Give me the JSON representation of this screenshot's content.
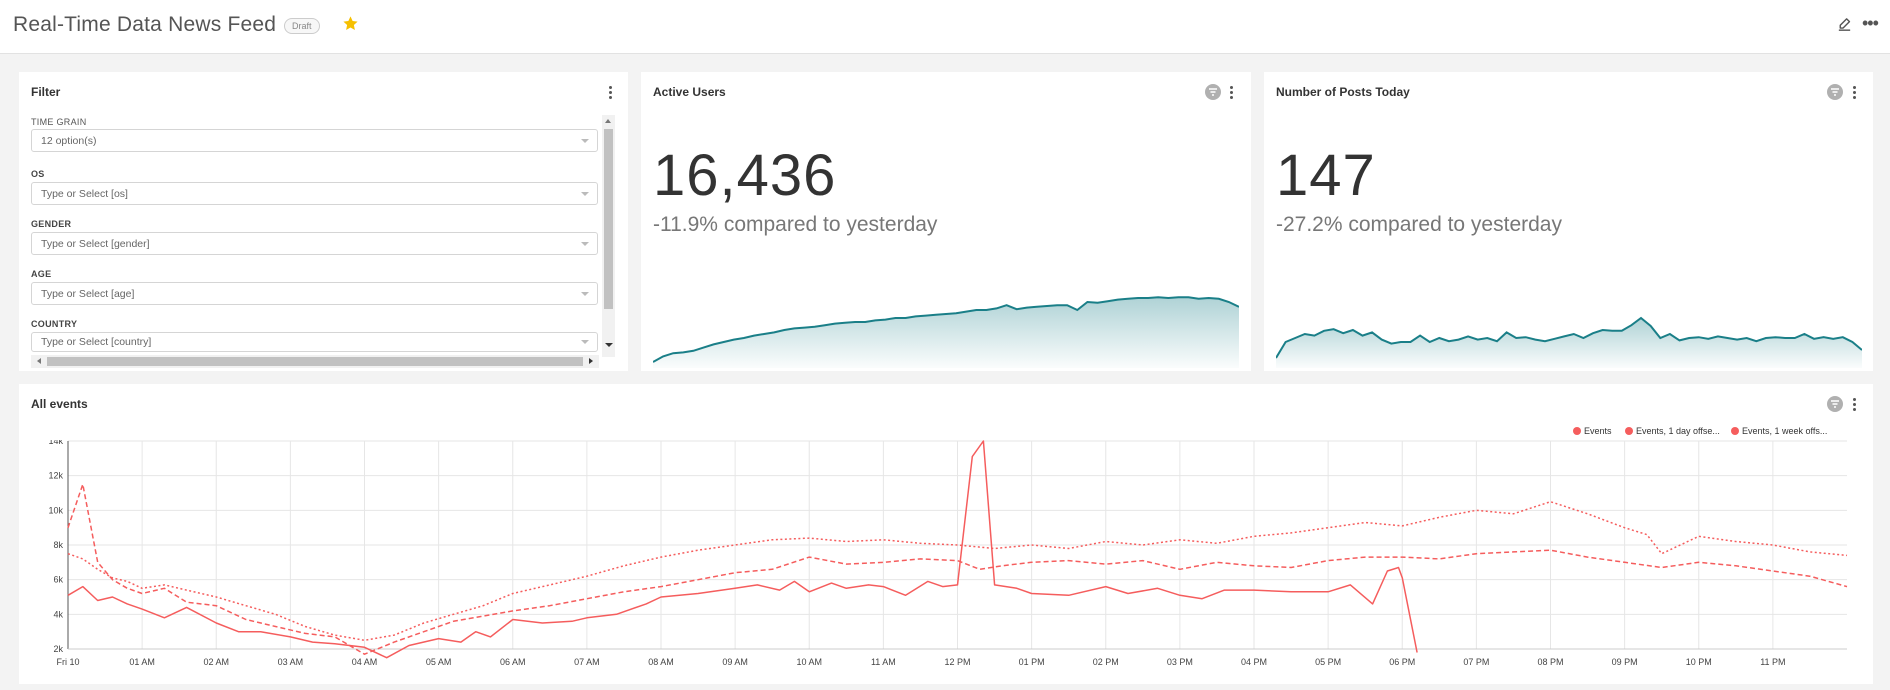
{
  "header": {
    "title": "Real-Time Data News Feed",
    "badge": "Draft",
    "icons": [
      "star-icon",
      "edit-icon",
      "more-icon"
    ],
    "star_color": "#f6c000"
  },
  "filter": {
    "title": "Filter",
    "fields": [
      {
        "label": "TIME GRAIN",
        "value": "12 option(s)"
      },
      {
        "label": "OS",
        "value": "Type or Select [os]"
      },
      {
        "label": "GENDER",
        "value": "Type or Select [gender]"
      },
      {
        "label": "AGE",
        "value": "Type or Select [age]"
      },
      {
        "label": "COUNTRY",
        "value": "Type or Select [country]"
      }
    ]
  },
  "active_users": {
    "title": "Active Users",
    "value": "16,436",
    "comparison": "-11.9% compared to yesterday"
  },
  "posts": {
    "title": "Number of Posts Today",
    "value": "147",
    "comparison": "-27.2% compared to yesterday"
  },
  "events": {
    "title": "All events",
    "legend": [
      "Events",
      "Events, 1 day offse...",
      "Events, 1 week offs..."
    ]
  },
  "colors": {
    "accent_teal": "#1a7f88",
    "events_red": "#f55d5d"
  },
  "chart_data": [
    {
      "type": "area",
      "name": "Active Users sparkline",
      "values": [
        5,
        12,
        16,
        17,
        19,
        23,
        27,
        30,
        33,
        35,
        38,
        40,
        42,
        45,
        47,
        48,
        49,
        51,
        53,
        54,
        55,
        55,
        57,
        58,
        60,
        60,
        62,
        63,
        64,
        65,
        66,
        68,
        70,
        70,
        72,
        76,
        71,
        73,
        74,
        75,
        76,
        76,
        70,
        80,
        79,
        81,
        83,
        84,
        85,
        85,
        86,
        85,
        86,
        86,
        84,
        85,
        84,
        80,
        74
      ],
      "ylim": [
        0,
        100
      ]
    },
    {
      "type": "area",
      "name": "Number of Posts Today sparkline",
      "values": [
        10,
        30,
        35,
        40,
        38,
        44,
        46,
        41,
        45,
        38,
        42,
        33,
        28,
        30,
        30,
        38,
        30,
        35,
        31,
        33,
        37,
        33,
        35,
        31,
        42,
        35,
        36,
        33,
        31,
        34,
        37,
        40,
        35,
        41,
        45,
        44,
        44,
        51,
        60,
        50,
        35,
        40,
        32,
        35,
        36,
        34,
        37,
        35,
        33,
        35,
        31,
        35,
        36,
        35,
        35,
        40,
        34,
        36,
        34,
        36,
        30,
        20
      ],
      "ylim": [
        0,
        100
      ]
    },
    {
      "type": "line",
      "title": "All events",
      "x_ticks": [
        "Fri 10",
        "01 AM",
        "02 AM",
        "03 AM",
        "04 AM",
        "05 AM",
        "06 AM",
        "07 AM",
        "08 AM",
        "09 AM",
        "10 AM",
        "11 AM",
        "12 PM",
        "01 PM",
        "02 PM",
        "03 PM",
        "04 PM",
        "05 PM",
        "06 PM",
        "07 PM",
        "08 PM",
        "09 PM",
        "10 PM",
        "11 PM"
      ],
      "y_ticks": [
        "2k",
        "4k",
        "6k",
        "8k",
        "10k",
        "12k",
        "14k"
      ],
      "ylim": [
        2000,
        14000
      ],
      "xlim": [
        0,
        24
      ],
      "grid": true,
      "legend_position": "top-right",
      "series": [
        {
          "name": "Events",
          "style": "solid",
          "x": [
            0,
            0.2,
            0.4,
            0.6,
            0.8,
            1.0,
            1.3,
            1.6,
            2.0,
            2.3,
            2.6,
            3.0,
            3.3,
            3.6,
            4.0,
            4.3,
            4.6,
            5.0,
            5.3,
            5.5,
            5.7,
            6.0,
            6.4,
            6.8,
            7.0,
            7.4,
            7.8,
            8.0,
            8.5,
            9.0,
            9.3,
            9.6,
            9.8,
            10.0,
            10.3,
            10.5,
            10.8,
            11.0,
            11.3,
            11.6,
            11.8,
            12.0,
            12.2,
            12.35,
            12.5,
            12.8,
            13.0,
            13.5,
            14.0,
            14.3,
            14.7,
            15.0,
            15.3,
            15.6,
            16.0,
            16.5,
            17.0,
            17.3,
            17.6,
            17.8,
            17.95,
            18.0,
            18.2
          ],
          "y": [
            5100,
            5600,
            4800,
            5000,
            4600,
            4300,
            3800,
            4400,
            3500,
            3000,
            3000,
            2700,
            2400,
            2300,
            2100,
            1500,
            2200,
            2600,
            2400,
            3000,
            2700,
            3700,
            3500,
            3600,
            3800,
            4000,
            4600,
            5000,
            5200,
            5500,
            5700,
            5400,
            5900,
            5300,
            5800,
            5500,
            5700,
            5600,
            5100,
            5900,
            5600,
            5700,
            13100,
            14000,
            5700,
            5500,
            5200,
            5100,
            5600,
            5200,
            5500,
            5100,
            4900,
            5400,
            5400,
            5300,
            5300,
            5700,
            4600,
            6500,
            6700,
            6100,
            1800
          ]
        },
        {
          "name": "Events, 1 day offse...",
          "style": "dashed",
          "x": [
            0,
            0.2,
            0.4,
            0.6,
            0.8,
            1.0,
            1.3,
            1.6,
            2.0,
            2.4,
            2.8,
            3.2,
            3.6,
            4.0,
            4.4,
            4.8,
            5.2,
            5.6,
            6.0,
            6.5,
            7.0,
            7.5,
            8.0,
            8.5,
            9.0,
            9.5,
            10.0,
            10.5,
            11.0,
            11.5,
            12.0,
            12.3,
            12.6,
            13.0,
            13.5,
            14.0,
            14.5,
            15.0,
            15.5,
            16.0,
            16.5,
            17.0,
            17.5,
            18.0,
            18.5,
            19.0,
            19.5,
            20.0,
            20.5,
            21.0,
            21.5,
            22.0,
            22.5,
            23.0,
            23.5,
            24.0
          ],
          "y": [
            9000,
            11500,
            7000,
            6000,
            5500,
            5200,
            5500,
            4700,
            4500,
            3700,
            3300,
            2900,
            2700,
            1700,
            2400,
            3000,
            3600,
            3900,
            4200,
            4500,
            4900,
            5300,
            5600,
            6000,
            6400,
            6600,
            7300,
            6900,
            7000,
            7200,
            7100,
            6600,
            6800,
            7000,
            7100,
            6900,
            7100,
            6600,
            7000,
            6800,
            6700,
            7100,
            7300,
            7300,
            7200,
            7500,
            7600,
            7700,
            7300,
            7000,
            6700,
            7000,
            6800,
            6500,
            6200,
            5600
          ]
        },
        {
          "name": "Events, 1 week offs...",
          "style": "dotted",
          "x": [
            0,
            0.2,
            0.4,
            0.6,
            0.8,
            1.0,
            1.3,
            1.6,
            2.0,
            2.4,
            2.8,
            3.2,
            3.6,
            4.0,
            4.4,
            4.8,
            5.2,
            5.6,
            6.0,
            6.5,
            7.0,
            7.5,
            8.0,
            8.5,
            9.0,
            9.5,
            10.0,
            10.5,
            11.0,
            11.5,
            12.0,
            12.5,
            13.0,
            13.5,
            14.0,
            14.5,
            15.0,
            15.5,
            16.0,
            16.5,
            17.0,
            17.5,
            18.0,
            18.5,
            19.0,
            19.5,
            20.0,
            20.5,
            21.0,
            21.3,
            21.5,
            22.0,
            22.5,
            23.0,
            23.5,
            24.0
          ],
          "y": [
            7500,
            7200,
            6600,
            6100,
            5900,
            5500,
            5700,
            5400,
            5000,
            4500,
            4000,
            3300,
            2800,
            2500,
            2800,
            3500,
            4000,
            4500,
            5200,
            5700,
            6200,
            6800,
            7300,
            7700,
            8000,
            8300,
            8400,
            8200,
            8300,
            8100,
            8000,
            7800,
            8000,
            7800,
            8200,
            8000,
            8300,
            8100,
            8500,
            8700,
            9000,
            9300,
            9100,
            9600,
            10000,
            9800,
            10500,
            9800,
            9000,
            8600,
            7500,
            8500,
            8200,
            8000,
            7600,
            7400
          ]
        }
      ]
    }
  ]
}
